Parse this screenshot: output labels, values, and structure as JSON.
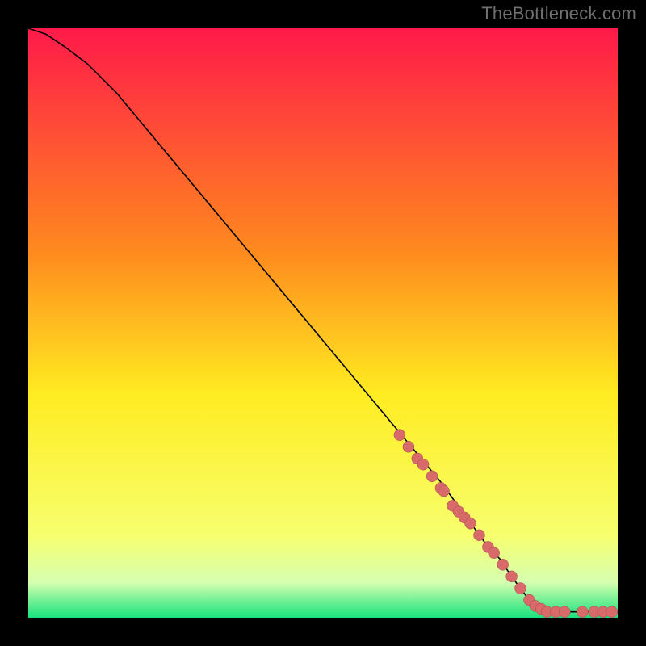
{
  "watermark": "TheBottleneck.com",
  "colors": {
    "background": "#000000",
    "gradient_top": "#ff1a4a",
    "gradient_mid1": "#ff8a1e",
    "gradient_mid2": "#ffec21",
    "gradient_mid3": "#f7ff6e",
    "gradient_mid4": "#d6ffb0",
    "gradient_bottom": "#17e27d",
    "curve": "#000000",
    "dot_fill": "#d86a6a",
    "dot_stroke": "#a04c4c"
  },
  "chart_data": {
    "type": "line",
    "title": "",
    "xlabel": "",
    "ylabel": "",
    "xlim": [
      0,
      100
    ],
    "ylim": [
      0,
      100
    ],
    "grid": false,
    "series": [
      {
        "name": "bottleneck-curve",
        "x": [
          0,
          3,
          6,
          10,
          15,
          20,
          30,
          40,
          50,
          60,
          70,
          78,
          80,
          82,
          85,
          88,
          92,
          96,
          100
        ],
        "values": [
          100,
          99,
          97,
          94,
          89,
          83,
          71,
          59,
          47,
          35,
          23,
          12,
          10,
          7,
          3,
          1,
          1,
          1,
          1
        ]
      }
    ],
    "highlight_points": {
      "name": "highlighted-range",
      "x": [
        63,
        64.5,
        66,
        67,
        68.5,
        70,
        70.5,
        72,
        73,
        74,
        75,
        76.5,
        78,
        79,
        80.5,
        82,
        83.5,
        85,
        86,
        87,
        88,
        89.5,
        91,
        94,
        96,
        97.5,
        99
      ],
      "values": [
        31,
        29,
        27,
        26,
        24,
        22,
        21.5,
        19,
        18,
        17,
        16,
        14,
        12,
        11,
        9,
        7,
        5,
        3,
        2,
        1.5,
        1,
        1,
        1,
        1,
        1,
        1,
        1
      ]
    }
  }
}
